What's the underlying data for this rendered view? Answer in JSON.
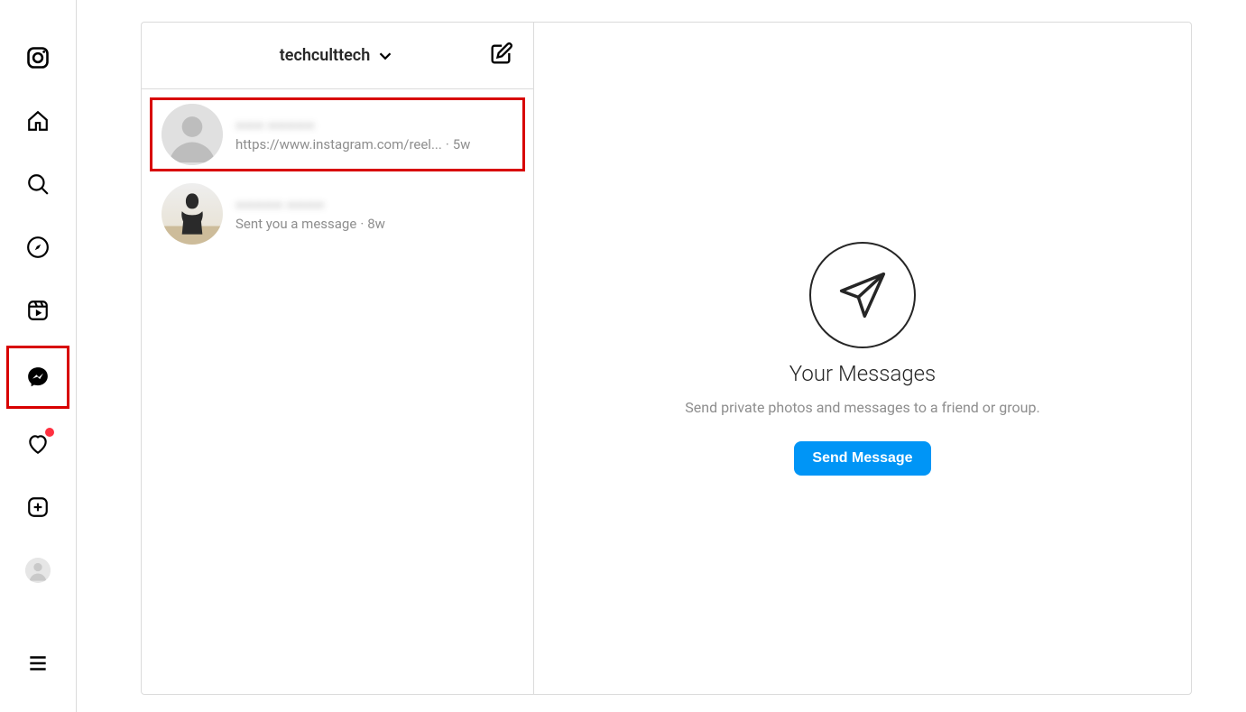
{
  "nav": {
    "items": [
      {
        "name": "logo"
      },
      {
        "name": "home"
      },
      {
        "name": "search"
      },
      {
        "name": "explore"
      },
      {
        "name": "reels"
      },
      {
        "name": "messages",
        "highlighted": true
      },
      {
        "name": "notifications",
        "badge": true
      },
      {
        "name": "create"
      },
      {
        "name": "profile"
      }
    ],
    "more": {
      "name": "more-menu"
    }
  },
  "dm": {
    "header": {
      "account_name": "techculttech"
    },
    "threads": [
      {
        "name_blurred": "––– –––––",
        "preview": "https://www.instagram.com/reel...",
        "time": "5w",
        "highlighted": true,
        "avatar": "placeholder"
      },
      {
        "name_blurred": "––––– ––––",
        "preview": "Sent you a message",
        "time": "8w",
        "highlighted": false,
        "avatar": "silhouette"
      }
    ],
    "empty": {
      "title": "Your Messages",
      "subtitle": "Send private photos and messages to a friend or group.",
      "button": "Send Message"
    }
  }
}
